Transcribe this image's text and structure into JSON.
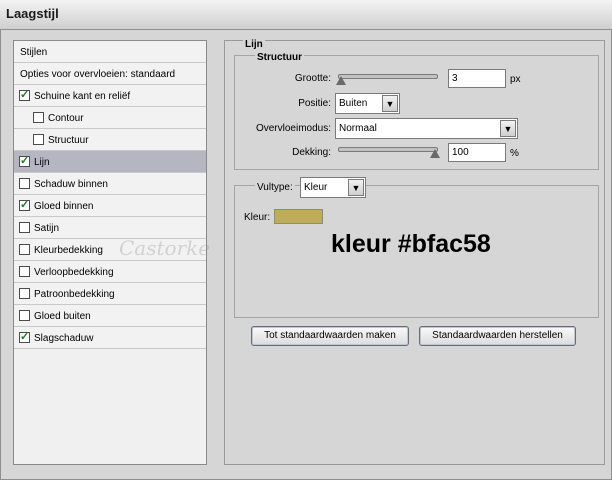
{
  "window": {
    "title": "Laagstijl"
  },
  "styles_list": {
    "header": "Stijlen",
    "blend_options": "Opties voor overvloeien: standaard",
    "items": [
      {
        "label": "Schuine kant en reliëf",
        "checked": true,
        "indent": false
      },
      {
        "label": "Contour",
        "checked": false,
        "indent": true
      },
      {
        "label": "Structuur",
        "checked": false,
        "indent": true
      },
      {
        "label": "Lijn",
        "checked": true,
        "indent": false,
        "selected": true
      },
      {
        "label": "Schaduw binnen",
        "checked": false,
        "indent": false
      },
      {
        "label": "Gloed binnen",
        "checked": true,
        "indent": false
      },
      {
        "label": "Satijn",
        "checked": false,
        "indent": false
      },
      {
        "label": "Kleurbedekking",
        "checked": false,
        "indent": false
      },
      {
        "label": "Verloopbedekking",
        "checked": false,
        "indent": false
      },
      {
        "label": "Patroonbedekking",
        "checked": false,
        "indent": false
      },
      {
        "label": "Gloed buiten",
        "checked": false,
        "indent": false
      },
      {
        "label": "Slagschaduw",
        "checked": true,
        "indent": false
      }
    ]
  },
  "stroke": {
    "section_title": "Lijn",
    "structure_title": "Structuur",
    "size_label": "Grootte:",
    "size_value": "3",
    "size_unit": "px",
    "position_label": "Positie:",
    "position_value": "Buiten",
    "blend_mode_label": "Overvloeimodus:",
    "blend_mode_value": "Normaal",
    "opacity_label": "Dekking:",
    "opacity_value": "100",
    "opacity_unit": "%",
    "fill_type_label": "Vultype:",
    "fill_type_value": "Kleur",
    "color_label": "Kleur:",
    "color_swatch": "#bfac58",
    "annotation": "kleur #bfac58"
  },
  "buttons": {
    "make_default": "Tot standaardwaarden maken",
    "reset_default": "Standaardwaarden herstellen"
  },
  "watermark": "Castorke"
}
